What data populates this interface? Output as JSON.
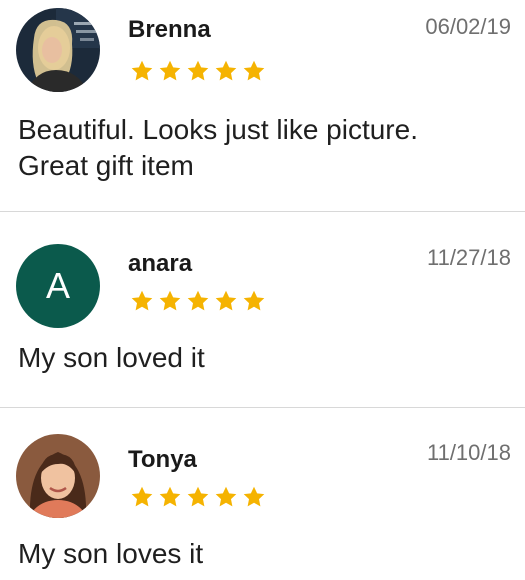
{
  "reviews": [
    {
      "name": "Brenna",
      "date": "06/02/19",
      "rating": 5,
      "text_lines": [
        "Beautiful. Looks just like picture.",
        "Great gift item"
      ],
      "avatar": {
        "type": "photo"
      }
    },
    {
      "name": "anara",
      "date": "11/27/18",
      "rating": 5,
      "text_lines": [
        "My son loved it"
      ],
      "avatar": {
        "type": "initial",
        "initial": "A",
        "color": "#0b5a4c"
      }
    },
    {
      "name": "Tonya",
      "date": "11/10/18",
      "rating": 5,
      "text_lines": [
        "My son loves it"
      ],
      "avatar": {
        "type": "photo"
      }
    }
  ],
  "colors": {
    "star": "#f5b301",
    "divider": "#d8d8d8"
  },
  "icons": {
    "star": "star-icon"
  }
}
